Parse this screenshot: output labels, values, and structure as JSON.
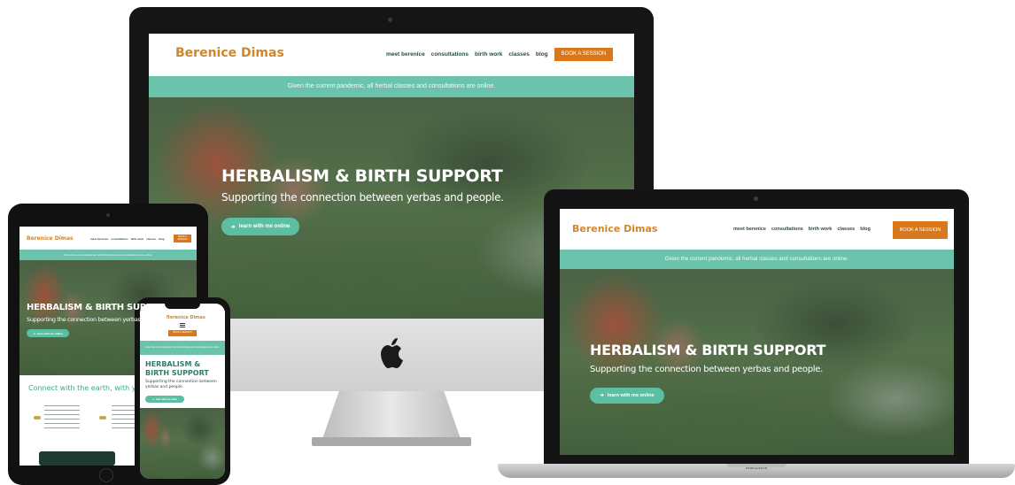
{
  "site": {
    "brand": "Berenice Dimas",
    "nav_items": [
      "meet berenice",
      "consultations",
      "birth work",
      "classes",
      "blog"
    ],
    "book_button": "BOOK A SESSION",
    "banner": "Given the current pandemic, all herbal classes and consultations are online.",
    "hero_title": "HERBALISM & BIRTH SUPPORT",
    "hero_subtitle": "Supporting the connection between yerbas and people.",
    "cta_label": "learn with me online",
    "section_heading": "Connect with the earth, with yourself, an"
  },
  "laptop": {
    "label": "MacBook"
  },
  "colors": {
    "brand": "#d0862c",
    "book_button": "#d9781a",
    "banner": "#6cc3ac",
    "cta": "#5cbfa4",
    "nav_text": "#2d4a44",
    "device_frame": "#161616",
    "imac_chin": "#d9d9d9",
    "laptop_body": "#b9b9bb"
  },
  "icons": [
    "apple-logo-icon",
    "arrow-right-icon",
    "camera-icon",
    "hamburger-menu-icon"
  ]
}
